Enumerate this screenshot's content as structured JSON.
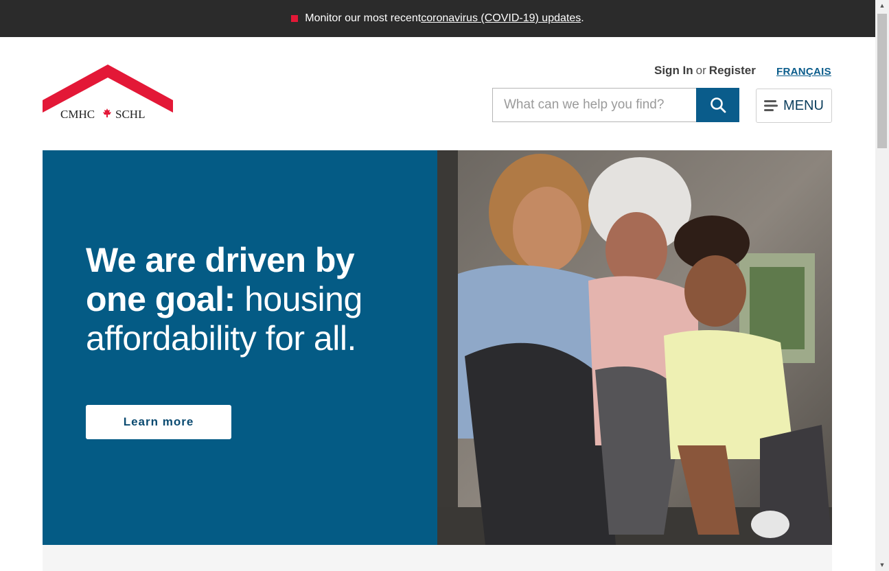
{
  "alert": {
    "prefix": "Monitor our most recent ",
    "link": "coronavirus (COVID-19) updates",
    "suffix": ".",
    "accent": "#e31837"
  },
  "header": {
    "logo_text_left": "CMHC",
    "logo_text_right": "SCHL",
    "sign_in": "Sign In",
    "or": "or",
    "register": "Register",
    "language": "FRANÇAIS",
    "search_placeholder": "What can we help you find?",
    "menu_label": "MENU"
  },
  "hero": {
    "heading_bold": "We are driven by one goal:",
    "heading_rest": " housing affordability for all.",
    "cta": "Learn more",
    "panel_color": "#045b85"
  },
  "colors": {
    "brand_blue": "#0a5c8b",
    "brand_red": "#e31837",
    "alert_bg": "#2b2b2b"
  }
}
